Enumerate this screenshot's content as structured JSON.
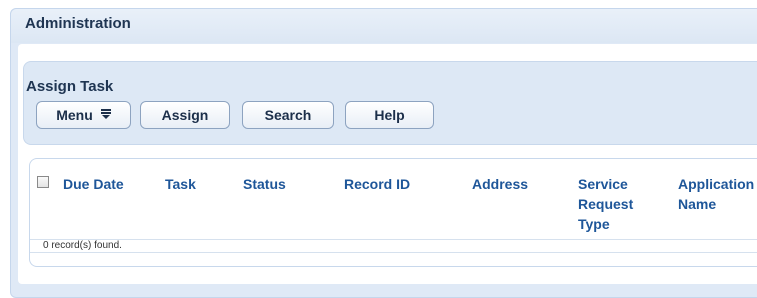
{
  "admin_panel": {
    "title": "Administration"
  },
  "assign_task": {
    "title": "Assign Task",
    "buttons": {
      "menu": "Menu",
      "assign": "Assign",
      "search": "Search",
      "help": "Help"
    },
    "menu_icon": "double-bar-down-icon"
  },
  "grid": {
    "columns": [
      "Due Date",
      "Task",
      "Status",
      "Record ID",
      "Address",
      "Service Request Type",
      "Application Name"
    ],
    "select_all_checked": false,
    "status_text": "0 record(s) found."
  },
  "colors": {
    "panel_bg": "#dfe9f6",
    "header_text": "#1f3552",
    "column_text": "#1e5699"
  }
}
